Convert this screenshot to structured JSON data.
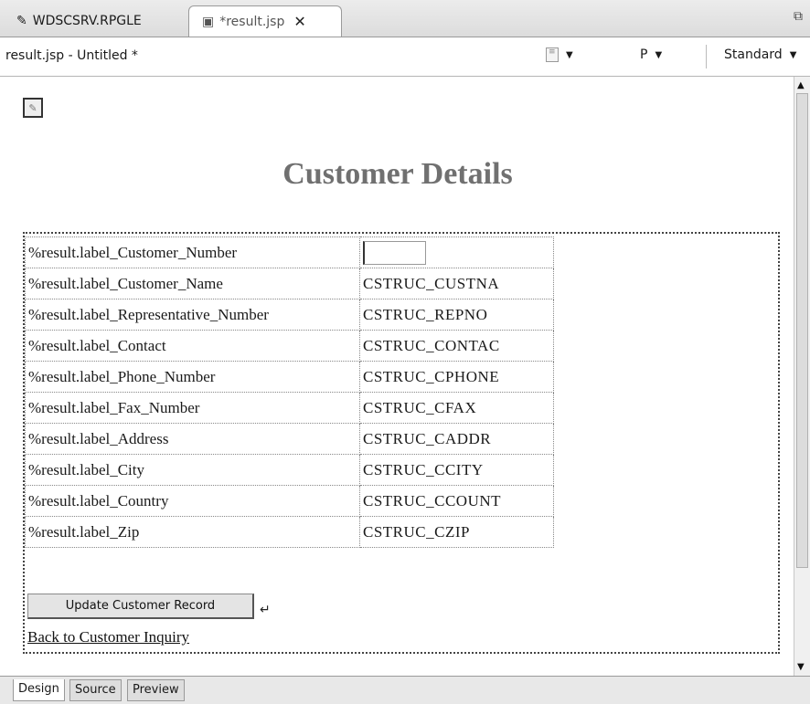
{
  "tabs": [
    {
      "label": "WDSCSRV.RPGLE",
      "icon": "pencil-icon"
    },
    {
      "label": "*result.jsp",
      "icon": "jsp-file-icon",
      "close": "✕"
    }
  ],
  "restore_icon": "restore-icon",
  "titlebar": {
    "document": "result.jsp - Untitled *",
    "paragraph_style": "P",
    "font_style": "Standard"
  },
  "page": {
    "heading": "Customer Details",
    "rows": [
      {
        "label": "%result.label_Customer_Number",
        "value": ""
      },
      {
        "label": "%result.label_Customer_Name",
        "value": "CSTRUC_CUSTNA"
      },
      {
        "label": "%result.label_Representative_Number",
        "value": "CSTRUC_REPNO"
      },
      {
        "label": "%result.label_Contact",
        "value": "CSTRUC_CONTAC"
      },
      {
        "label": "%result.label_Phone_Number",
        "value": "CSTRUC_CPHONE"
      },
      {
        "label": "%result.label_Fax_Number",
        "value": "CSTRUC_CFAX"
      },
      {
        "label": "%result.label_Address",
        "value": "CSTRUC_CADDR"
      },
      {
        "label": "%result.label_City",
        "value": "CSTRUC_CCITY"
      },
      {
        "label": "%result.label_Country",
        "value": "CSTRUC_CCOUNT"
      },
      {
        "label": "%result.label_Zip",
        "value": "CSTRUC_CZIP"
      }
    ],
    "update_button": "Update Customer Record",
    "enter_mark": "↵",
    "back_link": "Back to Customer Inquiry"
  },
  "bottom_tabs": [
    "Design",
    "Source",
    "Preview"
  ]
}
